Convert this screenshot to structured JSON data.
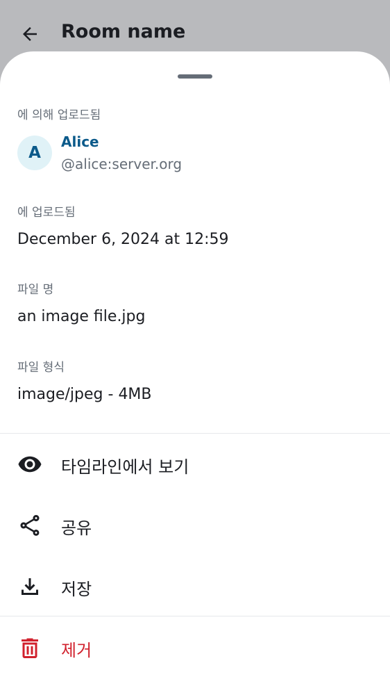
{
  "header": {
    "title": "Room name",
    "back_icon": "arrow-left-icon"
  },
  "sheet": {
    "uploaded_by": {
      "label": "에 의해 업로드됨",
      "avatar_initial": "A",
      "name": "Alice",
      "user_id": "@alice:server.org"
    },
    "uploaded_on": {
      "label": "에 업로드됨",
      "value": "December 6, 2024 at 12:59"
    },
    "file_name": {
      "label": "파일 명",
      "value": "an image file.jpg"
    },
    "file_format": {
      "label": "파일 형식",
      "value": "image/jpeg - 4MB"
    },
    "actions": [
      {
        "label": "타임라인에서 보기",
        "icon": "eye-icon"
      },
      {
        "label": "공유",
        "icon": "share-icon"
      },
      {
        "label": "저장",
        "icon": "download-icon"
      },
      {
        "label": "제거",
        "icon": "trash-icon"
      }
    ]
  },
  "colors": {
    "accent": "#0b5a8a",
    "danger": "#d1212d",
    "text_primary": "#1b1d22",
    "text_secondary": "#656d77",
    "scrim": "#b9babd"
  }
}
